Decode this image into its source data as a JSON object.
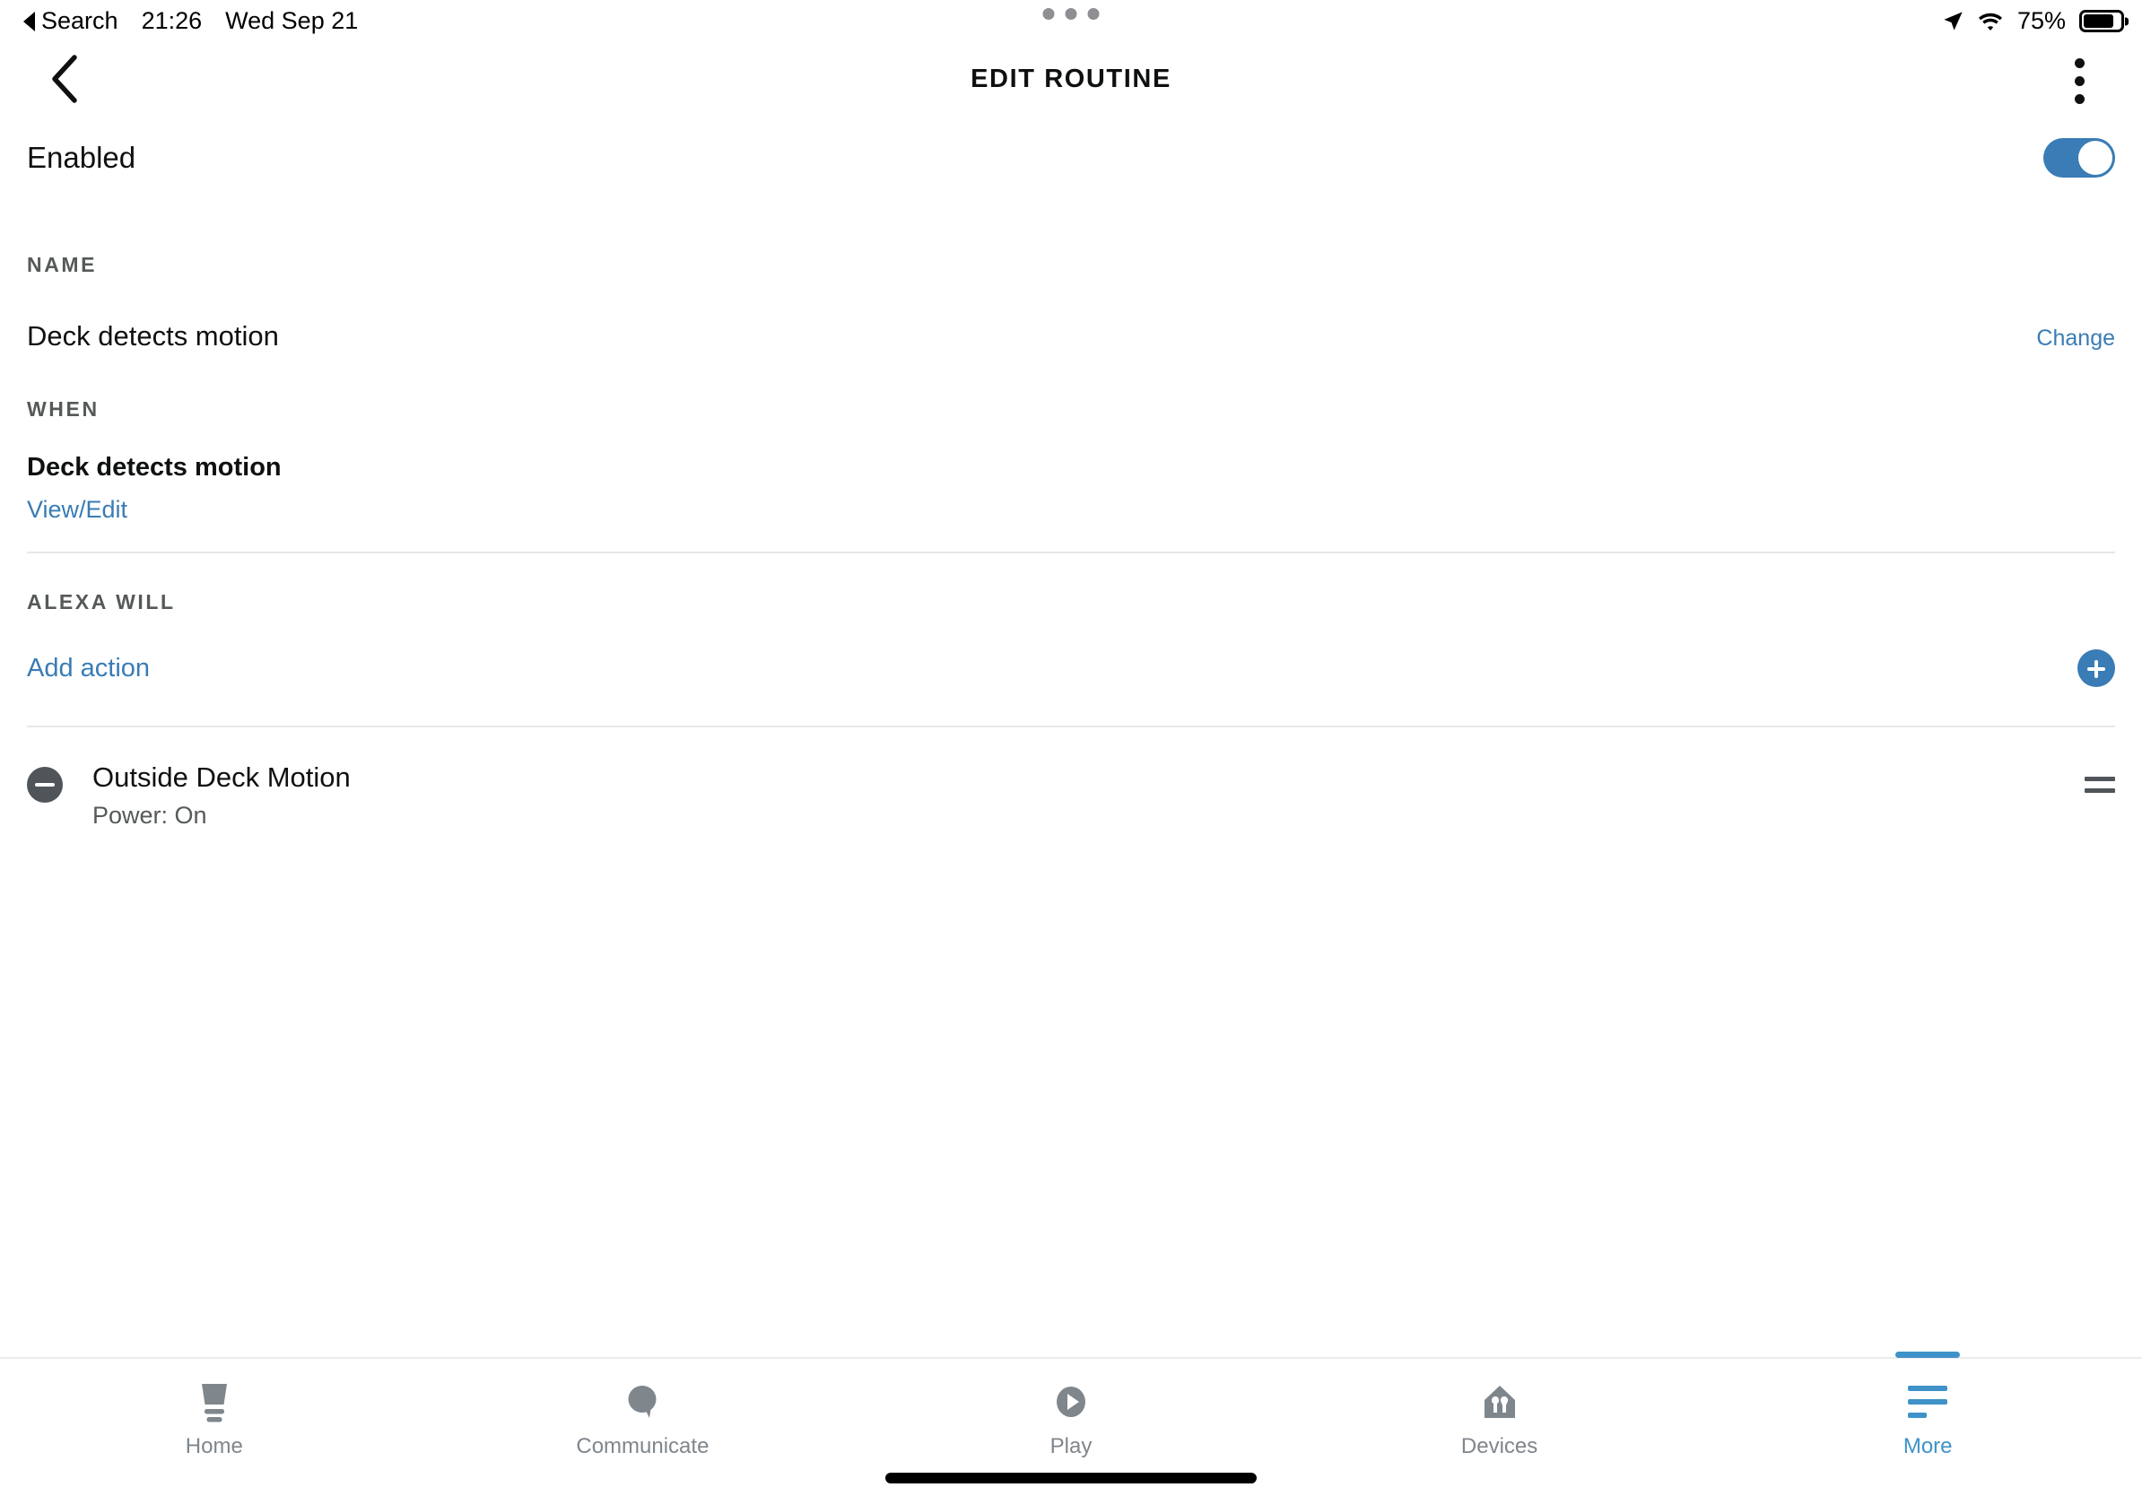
{
  "status_bar": {
    "back_app": "Search",
    "time": "21:26",
    "date": "Wed Sep 21",
    "battery_percent": "75%",
    "location_icon": "location-arrow-icon",
    "wifi_icon": "wifi-icon",
    "battery_icon": "battery-icon"
  },
  "header": {
    "title": "EDIT ROUTINE",
    "back_icon": "chevron-left-icon",
    "menu_icon": "overflow-menu-icon"
  },
  "enabled_row": {
    "label": "Enabled",
    "toggle_state": "on",
    "toggle_color": "#3a7cb5"
  },
  "name_section": {
    "header": "NAME",
    "value": "Deck detects motion",
    "change_label": "Change"
  },
  "when_section": {
    "header": "WHEN",
    "trigger": "Deck detects motion",
    "view_edit_label": "View/Edit"
  },
  "alexa_will_section": {
    "header": "ALEXA WILL",
    "add_action_label": "Add action",
    "add_icon": "plus-circle-icon"
  },
  "actions": [
    {
      "remove_icon": "minus-circle-icon",
      "title": "Outside Deck Motion",
      "subtitle": "Power: On",
      "drag_icon": "drag-handle-icon"
    }
  ],
  "tab_bar": {
    "active": "More",
    "accent_color": "#3f92c8",
    "inactive_color": "#7f868c",
    "tabs": [
      {
        "label": "Home",
        "icon": "alexa-home-icon"
      },
      {
        "label": "Communicate",
        "icon": "speech-bubble-icon"
      },
      {
        "label": "Play",
        "icon": "play-circle-icon"
      },
      {
        "label": "Devices",
        "icon": "house-devices-icon"
      },
      {
        "label": "More",
        "icon": "hamburger-menu-icon"
      }
    ]
  }
}
